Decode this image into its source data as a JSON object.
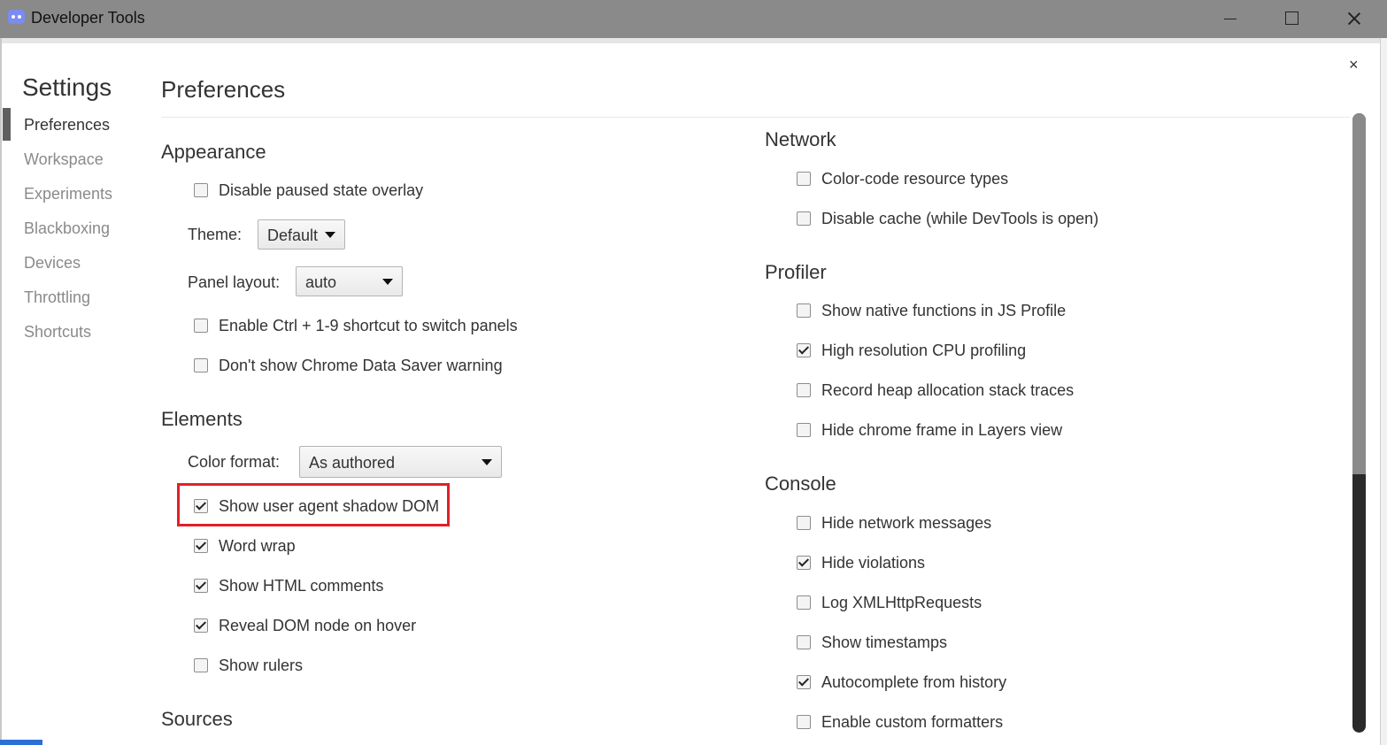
{
  "window": {
    "title": "Developer Tools",
    "icon": "discord-icon"
  },
  "sidebar": {
    "title": "Settings",
    "items": [
      {
        "label": "Preferences",
        "active": true
      },
      {
        "label": "Workspace"
      },
      {
        "label": "Experiments"
      },
      {
        "label": "Blackboxing"
      },
      {
        "label": "Devices"
      },
      {
        "label": "Throttling"
      },
      {
        "label": "Shortcuts"
      }
    ]
  },
  "main": {
    "title": "Preferences",
    "close_label": "×",
    "appearance": {
      "title": "Appearance",
      "disable_paused_overlay": {
        "label": "Disable paused state overlay",
        "checked": false
      },
      "theme": {
        "label": "Theme:",
        "value": "Default"
      },
      "panel_layout": {
        "label": "Panel layout:",
        "value": "auto"
      },
      "ctrl_shortcut": {
        "label": "Enable Ctrl + 1-9 shortcut to switch panels",
        "checked": false
      },
      "data_saver": {
        "label": "Don't show Chrome Data Saver warning",
        "checked": false
      }
    },
    "elements": {
      "title": "Elements",
      "color_format": {
        "label": "Color format:",
        "value": "As authored"
      },
      "shadow_dom": {
        "label": "Show user agent shadow DOM",
        "checked": true
      },
      "word_wrap": {
        "label": "Word wrap",
        "checked": true
      },
      "html_comments": {
        "label": "Show HTML comments",
        "checked": true
      },
      "reveal_dom": {
        "label": "Reveal DOM node on hover",
        "checked": true
      },
      "rulers": {
        "label": "Show rulers",
        "checked": false
      }
    },
    "sources": {
      "title": "Sources"
    },
    "network": {
      "title": "Network",
      "color_code": {
        "label": "Color-code resource types",
        "checked": false
      },
      "disable_cache": {
        "label": "Disable cache (while DevTools is open)",
        "checked": false
      }
    },
    "profiler": {
      "title": "Profiler",
      "native_functions": {
        "label": "Show native functions in JS Profile",
        "checked": false
      },
      "high_res": {
        "label": "High resolution CPU profiling",
        "checked": true
      },
      "heap_traces": {
        "label": "Record heap allocation stack traces",
        "checked": false
      },
      "chrome_frame": {
        "label": "Hide chrome frame in Layers view",
        "checked": false
      }
    },
    "console": {
      "title": "Console",
      "network_messages": {
        "label": "Hide network messages",
        "checked": false
      },
      "violations": {
        "label": "Hide violations",
        "checked": true
      },
      "xhr": {
        "label": "Log XMLHttpRequests",
        "checked": false
      },
      "timestamps": {
        "label": "Show timestamps",
        "checked": false
      },
      "autocomplete": {
        "label": "Autocomplete from history",
        "checked": true
      },
      "formatters": {
        "label": "Enable custom formatters",
        "checked": false
      }
    }
  },
  "colors": {
    "highlight": "#e0202a",
    "titlebar": "#8a8a8a"
  }
}
